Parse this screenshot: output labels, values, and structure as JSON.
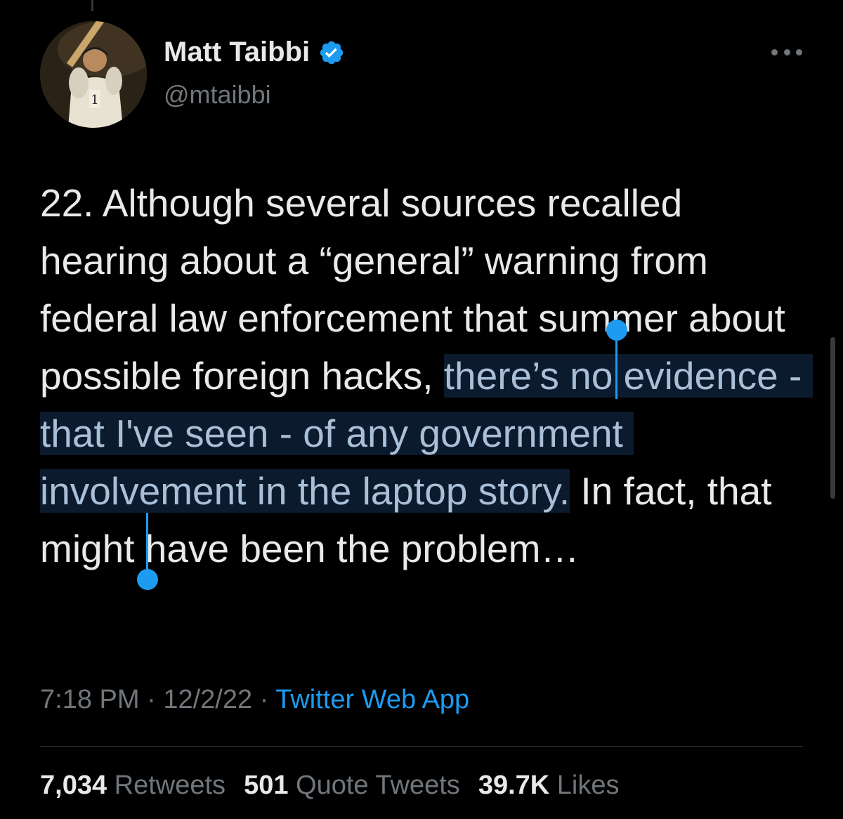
{
  "author": {
    "display_name": "Matt Taibbi",
    "handle": "@mtaibbi",
    "verified": true
  },
  "icons": {
    "avatar": "avatar-image",
    "verified": "verified-badge-icon",
    "more": "more-options-icon"
  },
  "tweet": {
    "text_before": "22. Although several sources recalled hearing about a “general” warning from federal law enforcement that summer about possible foreign hacks, ",
    "text_selected": "there’s no evidence - that I've seen - of any government involvement in the laptop story.",
    "text_after": " In fact, that might have been the problem…"
  },
  "meta": {
    "time": "7:18 PM",
    "separator": " · ",
    "date": "12/2/22",
    "source": "Twitter Web App"
  },
  "stats": {
    "retweets_count": "7,034",
    "retweets_label": "Retweets",
    "quotes_count": "501",
    "quotes_label": "Quote Tweets",
    "likes_count": "39.7K",
    "likes_label": "Likes"
  },
  "colors": {
    "background": "#000000",
    "text": "#e7e9ea",
    "secondary": "#71767b",
    "accent": "#1d9bf0",
    "selection_bg": "#0b1a2c"
  }
}
